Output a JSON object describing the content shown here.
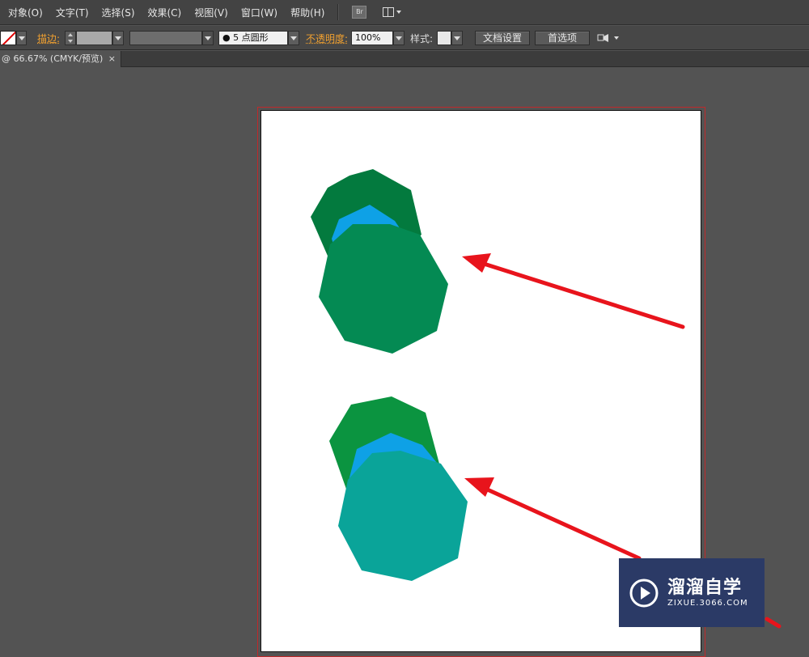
{
  "menu": [
    "对象(O)",
    "文字(T)",
    "选择(S)",
    "效果(C)",
    "视图(V)",
    "窗口(W)",
    "帮助(H)"
  ],
  "menu_icons": {
    "bridge": "Br",
    "arrange": "arrange-documents-icon"
  },
  "control": {
    "stroke_label": "描边:",
    "brush_label": "● 5 点圆形",
    "opacity_label": "不透明度:",
    "opacity_value": "100%",
    "style_label": "样式:",
    "doc_setup_btn": "文档设置",
    "prefs_btn": "首选项"
  },
  "document_tab": {
    "title": "@ 66.67% (CMYK/预览)",
    "close": "×"
  },
  "colors": {
    "upper_back": "#037a3e",
    "upper_mid": "#0ea1e6",
    "upper_front": "#048a53",
    "lower_back": "#0b9440",
    "lower_mid": "#0ea1e6",
    "lower_front": "#0aa499",
    "arrow": "#e8141c",
    "artboard_border": "#c0292a"
  },
  "watermark": {
    "title": "溜溜自学",
    "subtitle": "ZIXUE.3066.COM"
  }
}
